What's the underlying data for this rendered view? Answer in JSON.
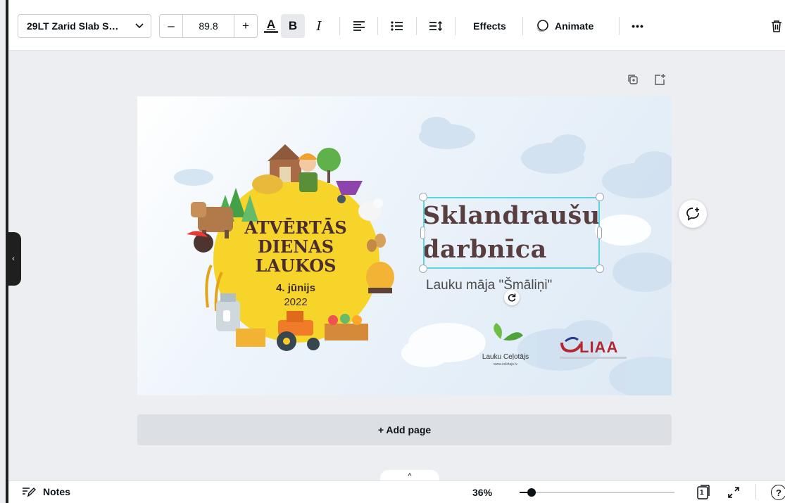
{
  "toolbar": {
    "font_name": "29LT Zarid Slab S…",
    "font_size": "89.8",
    "decrease_symbol": "–",
    "increase_symbol": "+",
    "text_color_letter": "A",
    "bold_letter": "B",
    "italic_letter": "I",
    "effects_label": "Effects",
    "animate_label": "Animate",
    "more_label": "•••"
  },
  "slide": {
    "event_title_line1": "ATVĒRTĀS",
    "event_title_line2": "DIENAS",
    "event_title_line3": "LAUKOS",
    "event_date": "4. jūnijs",
    "event_year": "2022",
    "headline_line1": "Sklandraušu",
    "headline_line2": "darbnīca",
    "subheadline": "Lauku māja \"Šmāliņi\"",
    "logo1_name": "Lauku Ceļotājs",
    "logo1_url": "www.celotajs.lv",
    "logo2_name": "LIAA"
  },
  "add_page_label": "+ Add page",
  "bottom": {
    "notes_label": "Notes",
    "zoom_percent": "36%",
    "zoom_level": 0.05,
    "page_count": "1"
  },
  "colors": {
    "accent": "#5dd3e0",
    "headline": "#5a3d3f",
    "sun": "#f7d42a",
    "liaa": "#b52730"
  }
}
